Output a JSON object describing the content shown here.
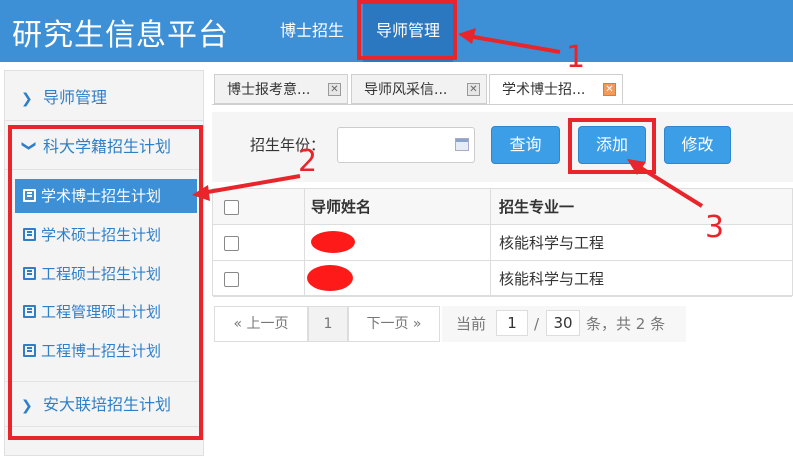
{
  "header": {
    "app_title": "研究生信息平台",
    "nav": [
      {
        "label": "博士招生"
      },
      {
        "label": "导师管理"
      }
    ]
  },
  "sidebar": {
    "sections": [
      {
        "label": "导师管理",
        "icon": "chevron-right-icon"
      },
      {
        "label": "科大学籍招生计划",
        "icon": "chevron-down-icon"
      },
      {
        "label": "安大联培招生计划",
        "icon": "chevron-right-icon"
      }
    ],
    "items": [
      {
        "label": "学术博士招生计划",
        "active": true
      },
      {
        "label": "学术硕士招生计划"
      },
      {
        "label": "工程硕士招生计划"
      },
      {
        "label": "工程管理硕士计划"
      },
      {
        "label": "工程博士招生计划"
      }
    ]
  },
  "tabs": [
    {
      "label": "博士报考意..."
    },
    {
      "label": "导师风采信..."
    },
    {
      "label": "学术博士招..."
    }
  ],
  "toolbar": {
    "year_label": "招生年份：",
    "year_value": "",
    "query_label": "查询",
    "add_label": "添加",
    "edit_label": "修改"
  },
  "table": {
    "headers": [
      "",
      "导师姓名",
      "招生专业一"
    ],
    "rows": [
      {
        "name": "",
        "major": "核能科学与工程"
      },
      {
        "name": "",
        "major": "核能科学与工程"
      }
    ]
  },
  "pager": {
    "prev": "« 上一页",
    "page": "1",
    "next": "下一页 »",
    "current_label": "当前",
    "current_page": "1",
    "slash": "/",
    "total_pages": "30",
    "summary": "条，共 2 条"
  },
  "annotations": {
    "num1": "1",
    "num2": "2",
    "num3": "3",
    "color": "#e8252a"
  },
  "colors": {
    "header_bg": "#3d8fd6",
    "active_nav": "#2b78c0",
    "button": "#3d9ee8",
    "sidebar_text": "#2f7fc8"
  }
}
